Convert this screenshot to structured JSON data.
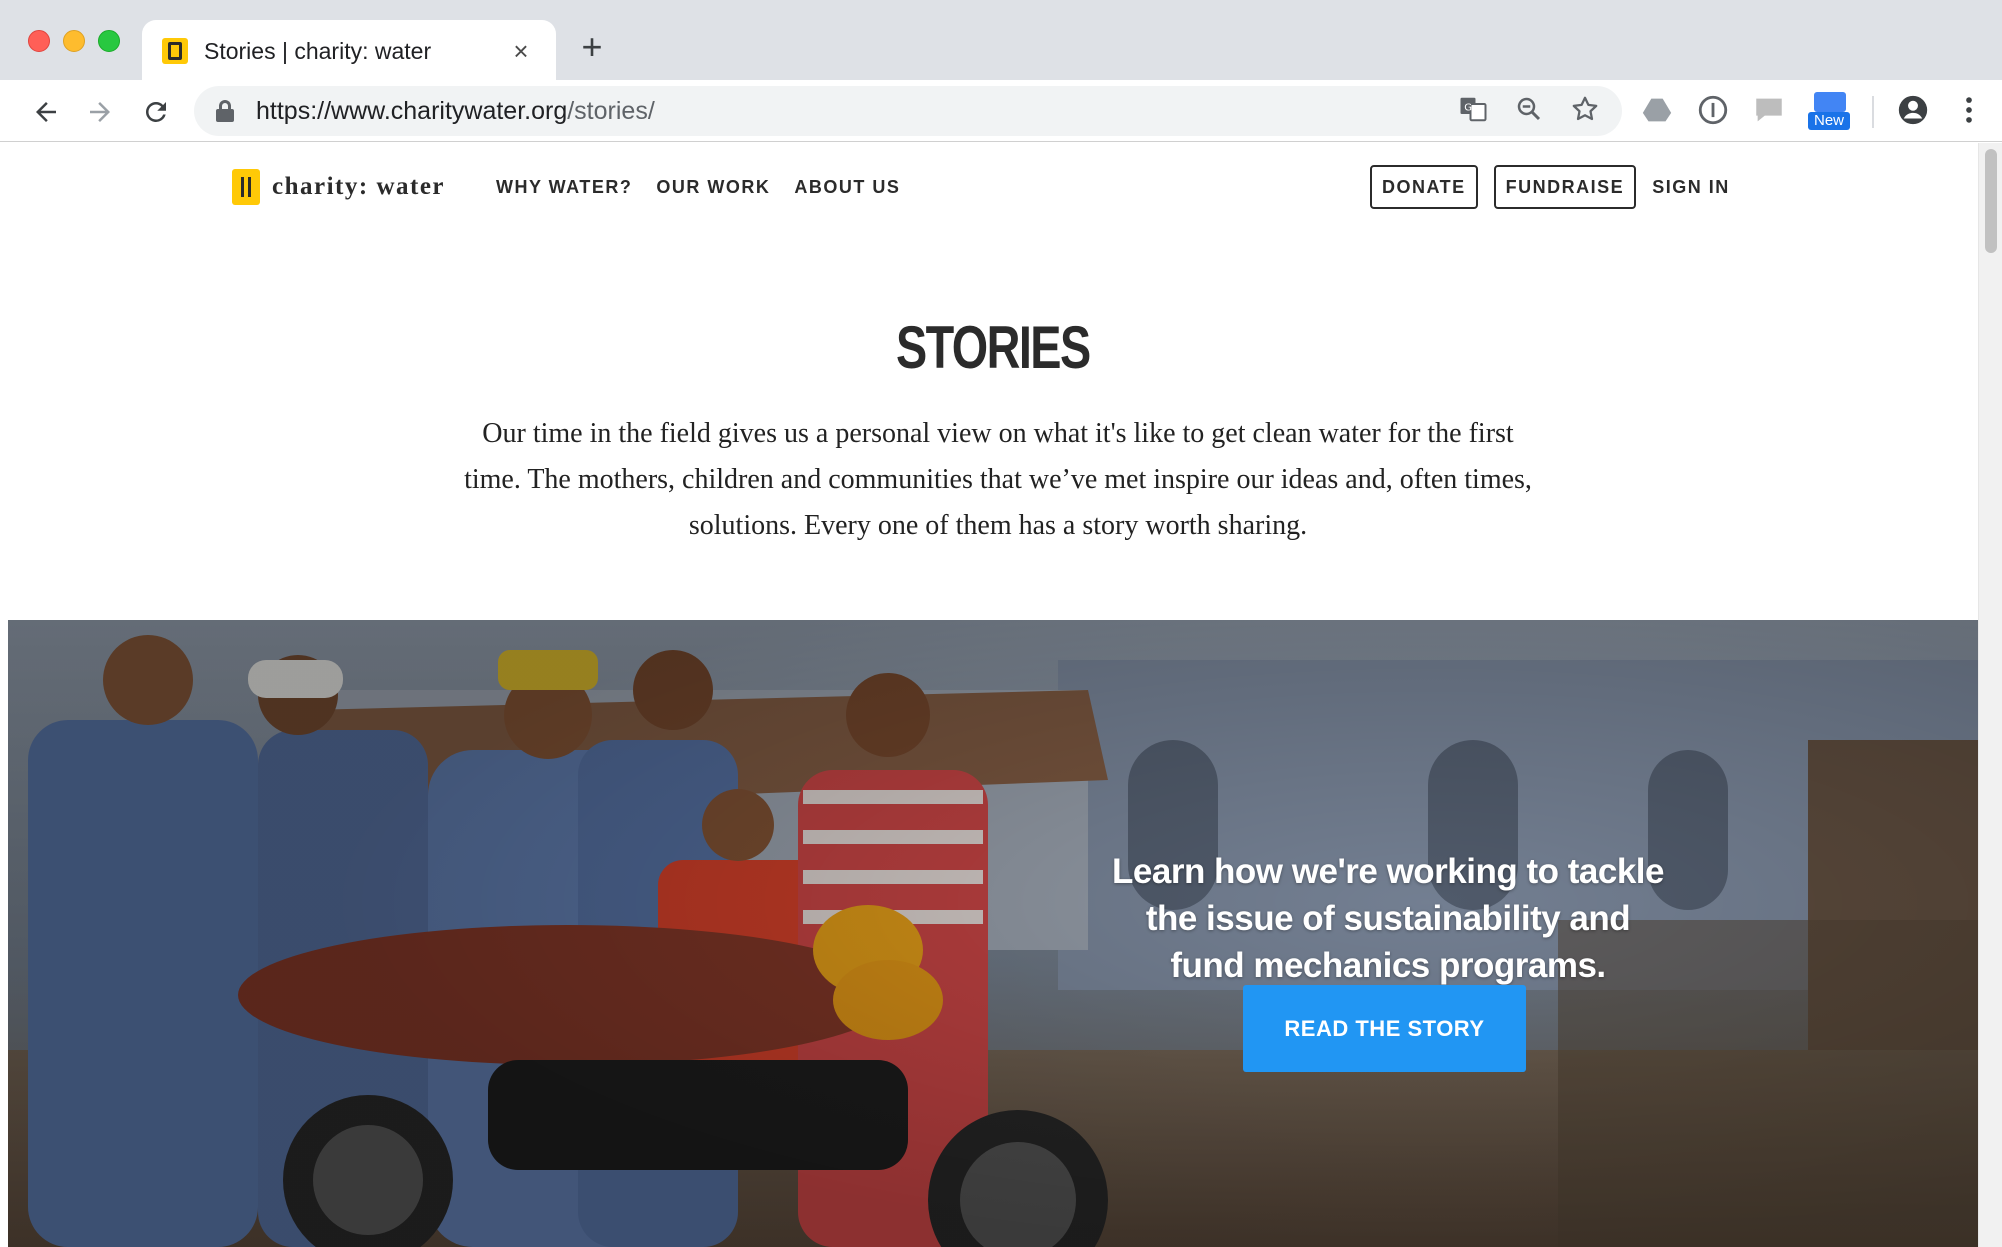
{
  "browser": {
    "tab_title": "Stories | charity: water",
    "tab_close": "×",
    "new_tab": "+",
    "url_host": "https://www.charitywater.org",
    "url_path": "/stories/",
    "extension_badge": "New"
  },
  "site": {
    "logo_text": "charity: water",
    "nav": [
      "WHY WATER?",
      "OUR WORK",
      "ABOUT US"
    ],
    "donate_label": "DONATE",
    "fundraise_label": "FUNDRAISE",
    "sign_in_label": "SIGN IN"
  },
  "page": {
    "title": "STORIES",
    "intro_line1": "Our time in the field gives us a personal view on what it's like to get clean water for the first",
    "intro_line2": "time. The mothers, children and communities that we’ve met inspire our ideas and, often times,",
    "intro_line3": "solutions. Every one of them has a story worth sharing."
  },
  "hero": {
    "line1": "Learn how we're working to tackle",
    "line2": "the issue of sustainability and",
    "line3": "fund mechanics programs.",
    "cta_label": "READ THE STORY"
  },
  "colors": {
    "brand_yellow": "#ffc907",
    "cta_blue": "#2196f3",
    "text_dark": "#2b2b2b"
  }
}
